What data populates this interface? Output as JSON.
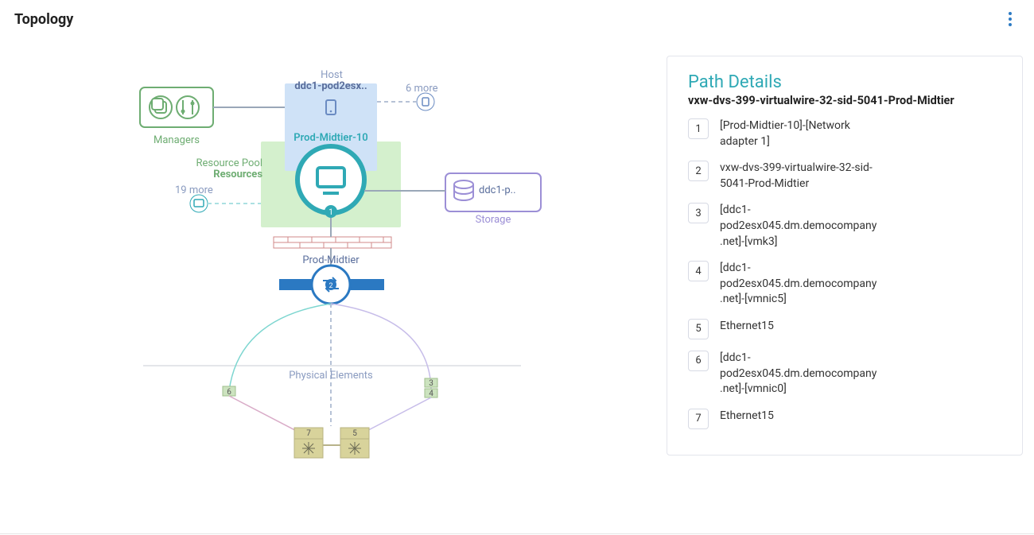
{
  "header": {
    "title": "Topology"
  },
  "topology": {
    "host_label": "Host",
    "host_name": "ddc1-pod2esx..",
    "vm_name": "Prod-Midtier-10",
    "managers_label": "Managers",
    "resource_pool_label": "Resource Pool",
    "resource_pool_name": "Resources",
    "more_vms_label": "19 more",
    "more_hosts_label": "6 more",
    "storage_name": "ddc1-p..",
    "storage_label": "Storage",
    "vswitch_label": "Prod-Midtier",
    "physical_label": "Physical Elements",
    "badge_vm": "1",
    "badge_switch": "2",
    "phys_left_top": "6",
    "phys_right_top_a": "3",
    "phys_right_top_b": "4",
    "phys_sw_left": "7",
    "phys_sw_right": "5"
  },
  "panel": {
    "title": "Path Details",
    "subtitle": "vxw-dvs-399-virtualwire-32-sid-5041-Prod-Midtier",
    "items": [
      {
        "num": "1",
        "text": "[Prod-Midtier-10]-[Network adapter 1]"
      },
      {
        "num": "2",
        "text": "vxw-dvs-399-virtualwire-32-sid-5041-Prod-Midtier"
      },
      {
        "num": "3",
        "text": "[ddc1-pod2esx045.dm.democompany.net]-[vmk3]"
      },
      {
        "num": "4",
        "text": "[ddc1-pod2esx045.dm.democompany.net]-[vmnic5]"
      },
      {
        "num": "5",
        "text": "Ethernet15"
      },
      {
        "num": "6",
        "text": "[ddc1-pod2esx045.dm.democompany.net]-[vmnic0]"
      },
      {
        "num": "7",
        "text": "Ethernet15"
      }
    ]
  }
}
